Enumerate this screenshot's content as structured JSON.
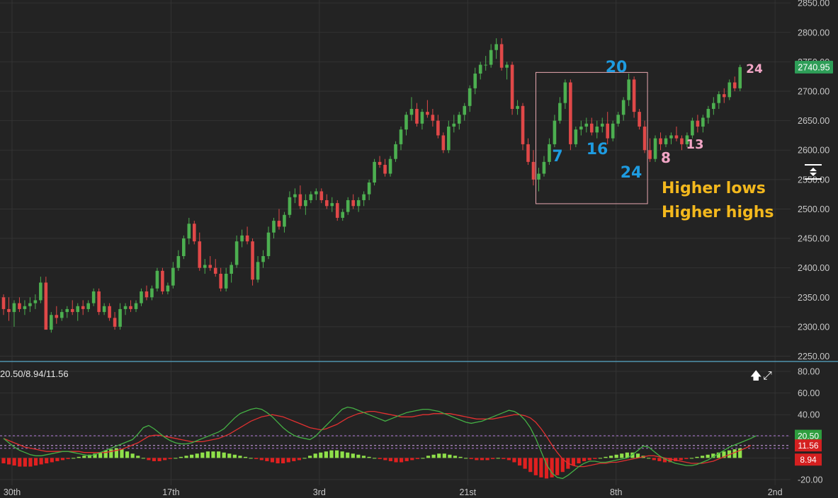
{
  "chart_data": [
    {
      "type": "candlestick",
      "title": "",
      "x_ticks": [
        "30th",
        "17th",
        "3rd",
        "21st",
        "8th",
        "2nd"
      ],
      "y_ticks": [
        "2250.00",
        "2300.00",
        "2350.00",
        "2400.00",
        "2450.00",
        "2500.00",
        "2550.00",
        "2600.00",
        "2650.00",
        "2700.00",
        "2750.00",
        "2800.00",
        "2850.00"
      ],
      "ylim": [
        2241,
        2855
      ],
      "last_price": "2740.95",
      "grid": true,
      "candles": [
        [
          2350,
          2355,
          2320,
          2330
        ],
        [
          2330,
          2350,
          2310,
          2325
        ],
        [
          2325,
          2345,
          2300,
          2340
        ],
        [
          2340,
          2350,
          2325,
          2330
        ],
        [
          2330,
          2345,
          2320,
          2335
        ],
        [
          2335,
          2350,
          2325,
          2340
        ],
        [
          2340,
          2355,
          2330,
          2345
        ],
        [
          2345,
          2385,
          2340,
          2375
        ],
        [
          2375,
          2385,
          2300,
          2295
        ],
        [
          2295,
          2325,
          2290,
          2320
        ],
        [
          2320,
          2335,
          2305,
          2315
        ],
        [
          2315,
          2330,
          2310,
          2325
        ],
        [
          2325,
          2335,
          2315,
          2330
        ],
        [
          2330,
          2345,
          2320,
          2325
        ],
        [
          2325,
          2340,
          2310,
          2335
        ],
        [
          2335,
          2345,
          2320,
          2330
        ],
        [
          2330,
          2345,
          2325,
          2340
        ],
        [
          2340,
          2365,
          2335,
          2360
        ],
        [
          2360,
          2365,
          2320,
          2325
        ],
        [
          2325,
          2340,
          2320,
          2335
        ],
        [
          2335,
          2340,
          2310,
          2315
        ],
        [
          2315,
          2325,
          2295,
          2300
        ],
        [
          2300,
          2340,
          2295,
          2330
        ],
        [
          2330,
          2340,
          2320,
          2335
        ],
        [
          2335,
          2345,
          2325,
          2330
        ],
        [
          2330,
          2345,
          2325,
          2340
        ],
        [
          2340,
          2365,
          2335,
          2360
        ],
        [
          2360,
          2370,
          2345,
          2350
        ],
        [
          2350,
          2370,
          2345,
          2365
        ],
        [
          2365,
          2400,
          2360,
          2395
        ],
        [
          2395,
          2400,
          2355,
          2360
        ],
        [
          2360,
          2375,
          2355,
          2370
        ],
        [
          2370,
          2410,
          2365,
          2400
        ],
        [
          2400,
          2430,
          2395,
          2420
        ],
        [
          2420,
          2455,
          2415,
          2450
        ],
        [
          2450,
          2485,
          2440,
          2475
        ],
        [
          2475,
          2480,
          2440,
          2445
        ],
        [
          2445,
          2460,
          2395,
          2400
        ],
        [
          2400,
          2415,
          2390,
          2405
        ],
        [
          2405,
          2420,
          2395,
          2400
        ],
        [
          2400,
          2415,
          2385,
          2390
        ],
        [
          2390,
          2400,
          2360,
          2365
        ],
        [
          2365,
          2400,
          2360,
          2390
        ],
        [
          2390,
          2410,
          2375,
          2405
        ],
        [
          2405,
          2455,
          2400,
          2445
        ],
        [
          2445,
          2465,
          2435,
          2455
        ],
        [
          2455,
          2470,
          2440,
          2445
        ],
        [
          2445,
          2450,
          2370,
          2380
        ],
        [
          2380,
          2420,
          2375,
          2410
        ],
        [
          2410,
          2430,
          2400,
          2420
        ],
        [
          2420,
          2470,
          2415,
          2460
        ],
        [
          2460,
          2485,
          2450,
          2480
        ],
        [
          2480,
          2500,
          2465,
          2470
        ],
        [
          2470,
          2495,
          2460,
          2490
        ],
        [
          2490,
          2530,
          2485,
          2520
        ],
        [
          2520,
          2535,
          2510,
          2525
        ],
        [
          2525,
          2540,
          2500,
          2505
        ],
        [
          2505,
          2525,
          2490,
          2515
        ],
        [
          2515,
          2530,
          2510,
          2525
        ],
        [
          2525,
          2535,
          2515,
          2530
        ],
        [
          2530,
          2535,
          2510,
          2515
        ],
        [
          2515,
          2525,
          2500,
          2505
        ],
        [
          2505,
          2520,
          2495,
          2510
        ],
        [
          2510,
          2515,
          2480,
          2485
        ],
        [
          2485,
          2500,
          2480,
          2495
        ],
        [
          2495,
          2520,
          2490,
          2515
        ],
        [
          2515,
          2525,
          2500,
          2505
        ],
        [
          2505,
          2520,
          2495,
          2515
        ],
        [
          2515,
          2530,
          2505,
          2525
        ],
        [
          2525,
          2550,
          2515,
          2545
        ],
        [
          2545,
          2585,
          2540,
          2580
        ],
        [
          2580,
          2590,
          2570,
          2575
        ],
        [
          2575,
          2585,
          2555,
          2560
        ],
        [
          2560,
          2590,
          2555,
          2585
        ],
        [
          2585,
          2615,
          2580,
          2610
        ],
        [
          2610,
          2640,
          2600,
          2635
        ],
        [
          2635,
          2665,
          2625,
          2660
        ],
        [
          2660,
          2690,
          2650,
          2670
        ],
        [
          2670,
          2680,
          2640,
          2645
        ],
        [
          2645,
          2670,
          2635,
          2665
        ],
        [
          2665,
          2685,
          2655,
          2660
        ],
        [
          2660,
          2670,
          2640,
          2650
        ],
        [
          2650,
          2660,
          2620,
          2625
        ],
        [
          2625,
          2630,
          2595,
          2600
        ],
        [
          2600,
          2650,
          2595,
          2640
        ],
        [
          2640,
          2660,
          2630,
          2645
        ],
        [
          2645,
          2665,
          2635,
          2660
        ],
        [
          2660,
          2680,
          2650,
          2675
        ],
        [
          2675,
          2710,
          2665,
          2705
        ],
        [
          2705,
          2740,
          2695,
          2730
        ],
        [
          2730,
          2750,
          2720,
          2745
        ],
        [
          2745,
          2760,
          2735,
          2745
        ],
        [
          2745,
          2780,
          2740,
          2770
        ],
        [
          2770,
          2790,
          2755,
          2780
        ],
        [
          2780,
          2790,
          2735,
          2740
        ],
        [
          2740,
          2750,
          2720,
          2745
        ],
        [
          2745,
          2750,
          2660,
          2670
        ],
        [
          2670,
          2685,
          2660,
          2675
        ],
        [
          2675,
          2680,
          2600,
          2610
        ],
        [
          2610,
          2620,
          2575,
          2580
        ],
        [
          2580,
          2600,
          2540,
          2550
        ],
        [
          2550,
          2570,
          2530,
          2560
        ],
        [
          2560,
          2590,
          2555,
          2580
        ],
        [
          2580,
          2620,
          2575,
          2610
        ],
        [
          2610,
          2660,
          2605,
          2650
        ],
        [
          2650,
          2690,
          2645,
          2680
        ],
        [
          2680,
          2720,
          2670,
          2715
        ],
        [
          2715,
          2720,
          2600,
          2610
        ],
        [
          2610,
          2640,
          2605,
          2635
        ],
        [
          2635,
          2650,
          2625,
          2640
        ],
        [
          2640,
          2655,
          2630,
          2645
        ],
        [
          2645,
          2655,
          2625,
          2630
        ],
        [
          2630,
          2650,
          2620,
          2640
        ],
        [
          2640,
          2655,
          2630,
          2645
        ],
        [
          2645,
          2665,
          2610,
          2620
        ],
        [
          2620,
          2650,
          2615,
          2645
        ],
        [
          2645,
          2665,
          2640,
          2660
        ],
        [
          2660,
          2690,
          2650,
          2685
        ],
        [
          2685,
          2730,
          2675,
          2720
        ],
        [
          2720,
          2725,
          2655,
          2665
        ],
        [
          2665,
          2670,
          2635,
          2640
        ],
        [
          2640,
          2650,
          2595,
          2600
        ],
        [
          2600,
          2620,
          2580,
          2585
        ],
        [
          2585,
          2625,
          2580,
          2620
        ],
        [
          2620,
          2630,
          2600,
          2610
        ],
        [
          2610,
          2625,
          2605,
          2620
        ],
        [
          2620,
          2630,
          2610,
          2625
        ],
        [
          2625,
          2640,
          2615,
          2620
        ],
        [
          2620,
          2625,
          2600,
          2610
        ],
        [
          2610,
          2630,
          2605,
          2625
        ],
        [
          2625,
          2655,
          2620,
          2650
        ],
        [
          2650,
          2660,
          2630,
          2640
        ],
        [
          2640,
          2660,
          2630,
          2655
        ],
        [
          2655,
          2675,
          2645,
          2670
        ],
        [
          2670,
          2690,
          2660,
          2680
        ],
        [
          2680,
          2700,
          2670,
          2695
        ],
        [
          2695,
          2705,
          2680,
          2690
        ],
        [
          2690,
          2720,
          2685,
          2715
        ],
        [
          2715,
          2725,
          2700,
          2705
        ],
        [
          2705,
          2745,
          2700,
          2741
        ]
      ],
      "annotations": [
        {
          "text": "20",
          "color": "#1e9be0"
        },
        {
          "text": "7",
          "color": "#1e9be0"
        },
        {
          "text": "16",
          "color": "#1e9be0"
        },
        {
          "text": "24",
          "color": "#1e9be0"
        },
        {
          "text": "8",
          "color": "#f2a6c6"
        },
        {
          "text": "13",
          "color": "#f2a6c6"
        },
        {
          "text": "24",
          "color": "#f2a6c6"
        },
        {
          "text": "Higher lows",
          "color": "#f3b81d"
        },
        {
          "text": "Higher highs",
          "color": "#f3b81d"
        }
      ],
      "box_range": {
        "x_start_index": 101,
        "x_end_index": 121,
        "y_low": 2509,
        "y_high": 2732
      }
    },
    {
      "type": "macd",
      "label": "20.50/8.94/11.56",
      "y_ticks": [
        "80.00",
        "60.00",
        "40.00",
        "20.00",
        "0.00",
        "-20.00"
      ],
      "ylim": [
        -22,
        82
      ],
      "line1_name": "20.50",
      "line2_name": "11.56",
      "hist_name": "8.94",
      "line1_value_label": "20.50",
      "line2_value_label": "11.56",
      "hist_value_label": "8.94",
      "ref_lines": [
        20.5,
        11.56,
        8.94
      ],
      "line1": [
        18,
        14,
        10,
        7,
        5,
        3,
        2,
        2,
        3,
        4,
        5,
        6,
        6,
        5,
        4,
        3,
        2,
        3,
        5,
        7,
        9,
        11,
        13,
        15,
        17,
        22,
        28,
        30,
        27,
        23,
        19,
        16,
        14,
        13,
        13,
        14,
        16,
        18,
        20,
        22,
        24,
        27,
        32,
        37,
        41,
        43,
        45,
        46,
        45,
        42,
        38,
        33,
        28,
        24,
        21,
        19,
        18,
        17,
        20,
        25,
        30,
        35,
        40,
        45,
        47,
        46,
        44,
        42,
        40,
        38,
        36,
        34,
        36,
        38,
        40,
        42,
        43,
        44,
        45,
        45,
        44,
        43,
        41,
        39,
        37,
        35,
        33,
        32,
        33,
        34,
        36,
        38,
        40,
        42,
        44,
        43,
        40,
        35,
        28,
        18,
        6,
        -6,
        -14,
        -18,
        -19,
        -16,
        -12,
        -8,
        -5,
        -3,
        -3,
        -4,
        -4,
        -3,
        -2,
        -1,
        0,
        3,
        7,
        11,
        10,
        6,
        2,
        -1,
        -3,
        -5,
        -6,
        -7,
        -7,
        -6,
        -4,
        -2,
        1,
        4,
        7,
        10,
        12,
        14,
        16,
        18,
        20.5
      ],
      "line2": [
        18,
        16,
        14,
        12,
        10,
        9,
        8,
        7,
        6,
        6,
        6,
        6,
        6,
        6,
        6,
        5,
        5,
        5,
        5,
        5,
        6,
        7,
        8,
        10,
        12,
        14,
        17,
        20,
        21,
        21,
        20,
        19,
        18,
        17,
        16,
        15,
        15,
        15,
        16,
        17,
        18,
        20,
        22,
        25,
        28,
        31,
        34,
        36,
        38,
        39,
        40,
        39,
        38,
        36,
        34,
        32,
        30,
        28,
        27,
        26,
        27,
        29,
        31,
        34,
        37,
        39,
        41,
        42,
        43,
        43,
        42,
        41,
        40,
        39,
        38,
        38,
        38,
        39,
        40,
        40,
        41,
        41,
        41,
        41,
        40,
        39,
        38,
        37,
        36,
        36,
        36,
        36,
        37,
        38,
        39,
        40,
        40,
        39,
        37,
        33,
        27,
        20,
        12,
        5,
        -1,
        -5,
        -7,
        -8,
        -8,
        -7,
        -6,
        -5,
        -5,
        -4,
        -4,
        -3,
        -2,
        -1,
        0,
        1,
        2,
        2,
        1,
        0,
        -1,
        -2,
        -3,
        -4,
        -5,
        -5,
        -5,
        -4,
        -3,
        -1,
        1,
        3,
        5,
        7,
        9,
        11.56
      ],
      "hist": [
        -5,
        -6,
        -7,
        -8,
        -8,
        -8,
        -7,
        -6,
        -5,
        -4,
        -3,
        -2,
        -1,
        0,
        1,
        2,
        3,
        4,
        5,
        7,
        8,
        9,
        8,
        6,
        4,
        2,
        0,
        -2,
        -3,
        -3,
        -2,
        -1,
        0,
        1,
        2,
        3,
        4,
        5,
        6,
        6,
        6,
        5,
        4,
        3,
        2,
        1,
        0,
        -1,
        -2,
        -3,
        -4,
        -5,
        -5,
        -4,
        -3,
        -2,
        0,
        2,
        4,
        5,
        6,
        7,
        7,
        6,
        5,
        4,
        3,
        2,
        1,
        0,
        -1,
        -2,
        -3,
        -4,
        -4,
        -3,
        -2,
        -1,
        0,
        2,
        3,
        4,
        4,
        3,
        2,
        1,
        0,
        -1,
        -2,
        -2,
        -2,
        -1,
        0,
        -1,
        -2,
        -4,
        -7,
        -10,
        -13,
        -16,
        -18,
        -19,
        -18,
        -16,
        -13,
        -10,
        -7,
        -5,
        -3,
        -2,
        -1,
        0,
        1,
        2,
        3,
        4,
        5,
        5,
        4,
        2,
        0,
        -2,
        -3,
        -4,
        -4,
        -3,
        -2,
        -1,
        0,
        1,
        2,
        3,
        4,
        5,
        6,
        7,
        8,
        8.94
      ]
    }
  ]
}
